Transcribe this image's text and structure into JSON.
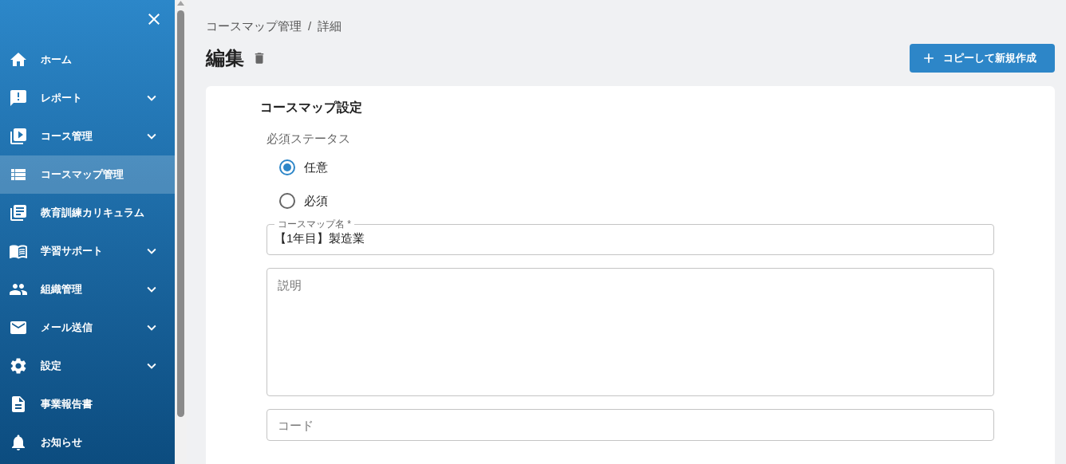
{
  "sidebar": {
    "items": [
      {
        "label": "ホーム",
        "selected": false,
        "has_submenu": false
      },
      {
        "label": "レポート",
        "selected": false,
        "has_submenu": true
      },
      {
        "label": "コース管理",
        "selected": false,
        "has_submenu": true
      },
      {
        "label": "コースマップ管理",
        "selected": true,
        "has_submenu": false
      },
      {
        "label": "教育訓練カリキュラム",
        "selected": false,
        "has_submenu": false
      },
      {
        "label": "学習サポート",
        "selected": false,
        "has_submenu": true
      },
      {
        "label": "組織管理",
        "selected": false,
        "has_submenu": true
      },
      {
        "label": "メール送信",
        "selected": false,
        "has_submenu": true
      },
      {
        "label": "設定",
        "selected": false,
        "has_submenu": true
      },
      {
        "label": "事業報告書",
        "selected": false,
        "has_submenu": false
      },
      {
        "label": "お知らせ",
        "selected": false,
        "has_submenu": false
      }
    ]
  },
  "breadcrumb": [
    "コースマップ管理",
    "詳細"
  ],
  "breadcrumb_separator": "/",
  "page_title": "編集",
  "copy_button": "コピーして新規作成",
  "form": {
    "section_title": "コースマップ設定",
    "status_label": "必須ステータス",
    "status_options": [
      {
        "label": "任意",
        "selected": true
      },
      {
        "label": "必須",
        "selected": false
      }
    ],
    "name_field": {
      "label": "コースマップ名 *",
      "value": "【1年目】製造業"
    },
    "description_field": {
      "placeholder": "説明"
    },
    "code_field": {
      "placeholder": "コード"
    }
  }
}
